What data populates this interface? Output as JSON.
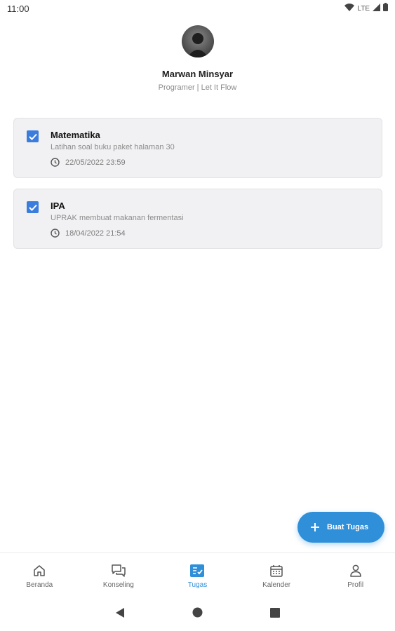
{
  "status_bar": {
    "time": "11:00",
    "network": "LTE",
    "icons": [
      "wifi-icon",
      "cell-signal-icon",
      "battery-icon"
    ]
  },
  "profile": {
    "name": "Marwan Minsyar",
    "subtitle": "Programer | Let It Flow"
  },
  "tasks": [
    {
      "title": "Matematika",
      "description": "Latihan soal buku paket halaman 30",
      "datetime": "22/05/2022 23:59",
      "checked": true
    },
    {
      "title": "IPA",
      "description": "UPRAK membuat makanan fermentasi",
      "datetime": "18/04/2022 21:54",
      "checked": true
    }
  ],
  "fab": {
    "label": "Buat Tugas",
    "icon": "plus-icon"
  },
  "bottom_nav": {
    "active": "Tugas",
    "items": [
      {
        "label": "Beranda",
        "icon": "home-icon"
      },
      {
        "label": "Konseling",
        "icon": "chat-icon"
      },
      {
        "label": "Tugas",
        "icon": "task-list-icon"
      },
      {
        "label": "Kalender",
        "icon": "calendar-icon"
      },
      {
        "label": "Profil",
        "icon": "person-icon"
      }
    ]
  },
  "colors": {
    "accent": "#2f8fd8",
    "checkbox": "#3b7ddd",
    "card_bg": "#f1f1f3"
  }
}
